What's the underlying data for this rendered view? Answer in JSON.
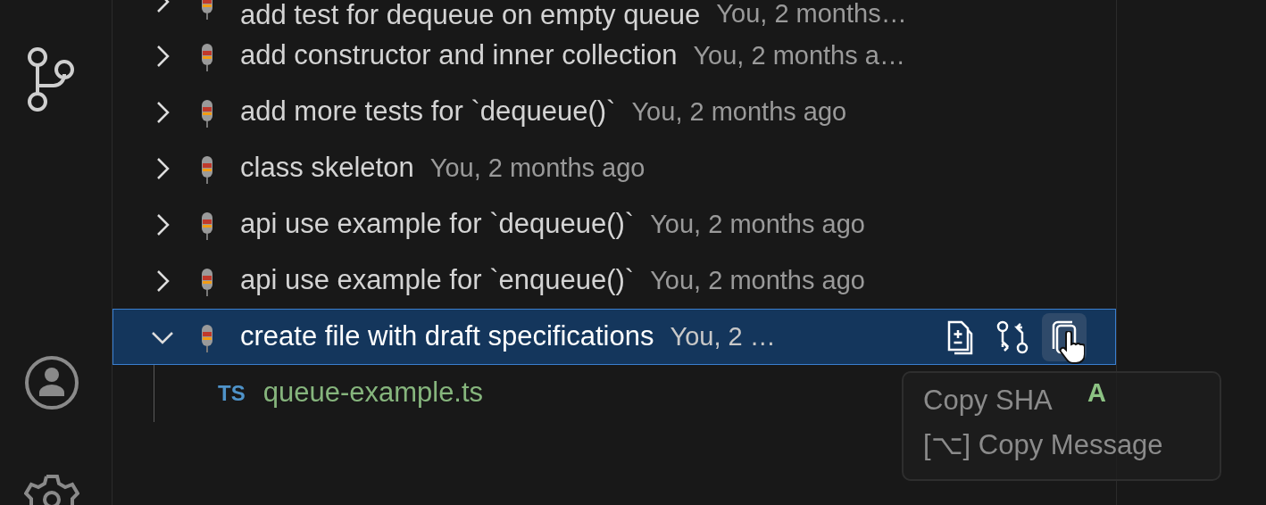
{
  "commits": [
    {
      "message": "add test for dequeue on empty queue",
      "meta": "You, 2 months…",
      "expanded": false,
      "selected": false
    },
    {
      "message": "add constructor and inner collection",
      "meta": "You, 2 months a…",
      "expanded": false,
      "selected": false
    },
    {
      "message": "add more tests for `dequeue()`",
      "meta": "You, 2 months ago",
      "expanded": false,
      "selected": false
    },
    {
      "message": "class skeleton",
      "meta": "You, 2 months ago",
      "expanded": false,
      "selected": false
    },
    {
      "message": "api use example for `dequeue()`",
      "meta": "You, 2 months ago",
      "expanded": false,
      "selected": false
    },
    {
      "message": "api use example for `enqueue()`",
      "meta": "You, 2 months ago",
      "expanded": false,
      "selected": false
    },
    {
      "message": "create file with draft specifications",
      "meta": "You, 2 …",
      "expanded": true,
      "selected": true,
      "actions": [
        {
          "kind": "open-changes",
          "hovered": false
        },
        {
          "kind": "compare",
          "hovered": false
        },
        {
          "kind": "copy",
          "hovered": true
        }
      ],
      "files": [
        {
          "badge": "TS",
          "name": "queue-example.ts",
          "status": "A"
        }
      ]
    }
  ],
  "tooltip": {
    "items": [
      "Copy SHA",
      "[⌥] Copy Message"
    ]
  }
}
